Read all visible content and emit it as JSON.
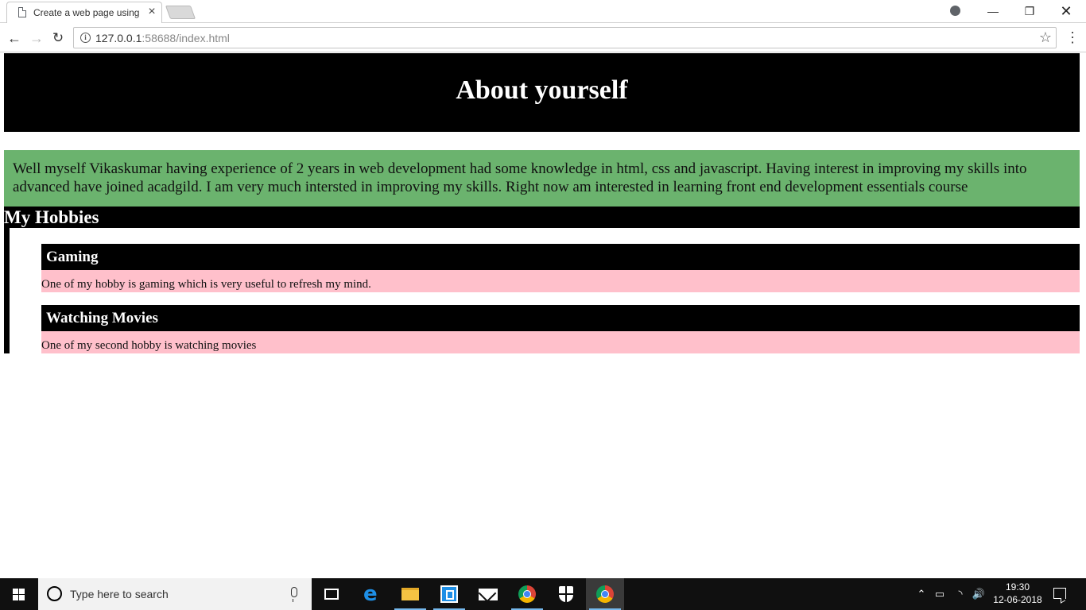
{
  "browser": {
    "tab_title": "Create a web page using",
    "url_host": "127.0.0.1",
    "url_rest": ":58688/index.html"
  },
  "page": {
    "title": "About yourself",
    "intro": "Well myself Vikaskumar having experience of 2 years in web development had some knowledge in html, css and javascript. Having interest in improving my skills into advanced have joined acadgild. I am very much intersted in improving my skills. Right now am interested in learning front end development essentials course",
    "hobbies_heading": "My Hobbies",
    "hobbies": [
      {
        "title": "Gaming",
        "description": "One of my hobby is gaming which is very useful to refresh my mind."
      },
      {
        "title": "Watching Movies",
        "description": "One of my second hobby is watching movies"
      }
    ],
    "colors": {
      "header_bg": "#000000",
      "intro_bg": "#6bb36e",
      "hobby_desc_bg": "#ffc0cb"
    }
  },
  "taskbar": {
    "search_placeholder": "Type here to search",
    "time": "19:30",
    "date": "12-06-2018"
  }
}
